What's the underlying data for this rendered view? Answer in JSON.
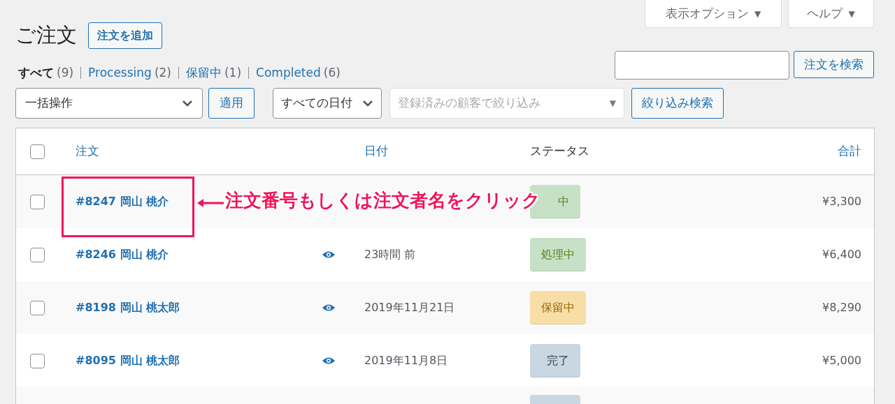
{
  "screen_tabs": [
    {
      "label": "表示オプション",
      "caret": "▼"
    },
    {
      "label": "ヘルプ",
      "caret": "▼"
    }
  ],
  "title": "ご注文",
  "add_button": "注文を追加",
  "status_filters": [
    {
      "label": "すべて",
      "count": "(9)",
      "selected": true
    },
    {
      "label": "Processing",
      "count": "(2)",
      "selected": false
    },
    {
      "label": "保留中",
      "count": "(1)",
      "selected": false
    },
    {
      "label": "Completed",
      "count": "(6)",
      "selected": false
    }
  ],
  "search": {
    "button": "注文を検索"
  },
  "bulk_action": {
    "value": "一括操作",
    "apply": "適用"
  },
  "date_filter": {
    "value": "すべての日付"
  },
  "customer_filter": {
    "placeholder": "登録済みの顧客で絞り込み",
    "caret": "▼"
  },
  "filter_button": "絞り込み検索",
  "table": {
    "select_all": {
      "checked": false
    },
    "columns": [
      "注文",
      "日付",
      "ステータス",
      "合計"
    ],
    "rows": [
      {
        "order": "#8247 岡山 桃介",
        "preview": false,
        "status": {
          "kind": "processing",
          "label": "中"
        },
        "total": "¥3,300",
        "checked": false
      },
      {
        "order": "#8246 岡山 桃介",
        "preview": true,
        "date": "23時間 前",
        "status": {
          "kind": "processing",
          "label": "処理中"
        },
        "total": "¥6,400",
        "checked": false
      },
      {
        "order": "#8198 岡山 桃太郎",
        "preview": true,
        "date": "2019年11月21日",
        "status": {
          "kind": "on-hold",
          "label": "保留中"
        },
        "total": "¥8,290",
        "checked": false
      },
      {
        "order": "#8095 岡山 桃太郎",
        "preview": true,
        "date": "2019年11月8日",
        "status": {
          "kind": "completed",
          "label": "完了"
        },
        "total": "¥5,000",
        "checked": false
      },
      {
        "status": {
          "kind": "completed"
        }
      }
    ]
  },
  "annotation": {
    "text": "注文番号もしくは注文者名をクリック"
  }
}
